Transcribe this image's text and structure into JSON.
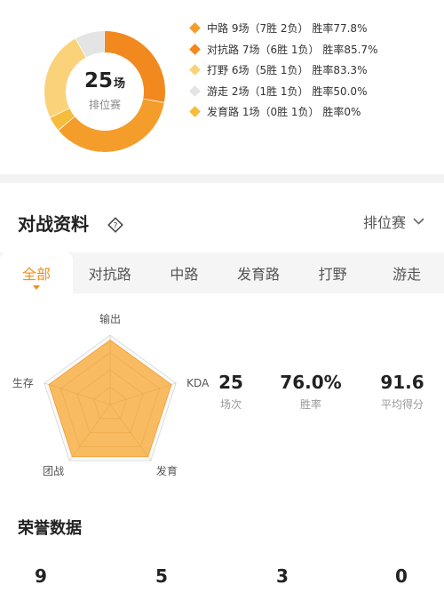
{
  "summary": {
    "count": "25",
    "count_unit": "场",
    "mode_label": "排位赛",
    "segments": [
      {
        "label": "中路 9场（7胜 2负） 胜率77.8%",
        "value": 9,
        "color": "#f59d2a"
      },
      {
        "label": "对抗路 7场（6胜 1负） 胜率85.7%",
        "value": 7,
        "color": "#f2891f"
      },
      {
        "label": "打野 6场（5胜 1负） 胜率83.3%",
        "value": 6,
        "color": "#f9d27a"
      },
      {
        "label": "游走 2场（1胜 1负） 胜率50.0%",
        "value": 2,
        "color": "#e4e4e4"
      },
      {
        "label": "发育路 1场（0胜 1负） 胜率0%",
        "value": 1,
        "color": "#f6bd3c"
      }
    ]
  },
  "battle": {
    "title": "对战资料",
    "help_icon": "question-diamond-icon",
    "mode_select": "排位赛",
    "tabs": [
      "全部",
      "对抗路",
      "中路",
      "发育路",
      "打野",
      "游走"
    ],
    "active_tab": 0,
    "radar": {
      "axes": [
        "输出",
        "KDA",
        "发育",
        "团战",
        "生存"
      ],
      "values": [
        0.93,
        0.93,
        0.93,
        0.93,
        0.93
      ],
      "fill_color": "#f8b75a"
    },
    "stats": [
      {
        "value": "25",
        "label": "场次"
      },
      {
        "value": "76.0%",
        "label": "胜率"
      },
      {
        "value": "91.6",
        "label": "平均得分"
      }
    ]
  },
  "honor": {
    "title": "荣誉数据",
    "items": [
      {
        "value": "9"
      },
      {
        "value": "5"
      },
      {
        "value": "3"
      },
      {
        "value": "0"
      }
    ]
  }
}
